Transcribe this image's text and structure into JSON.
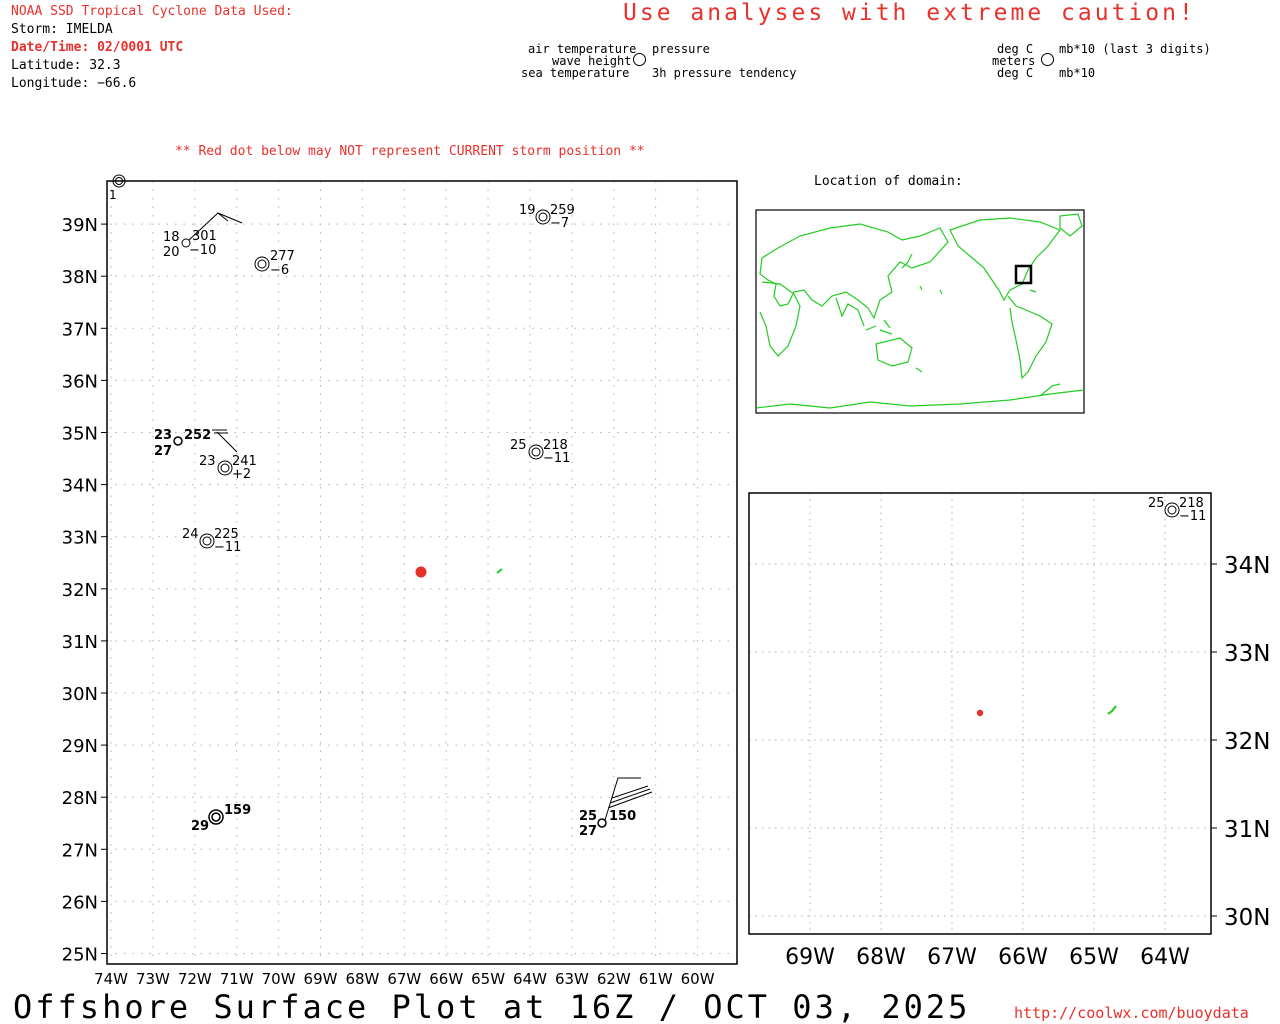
{
  "header": {
    "source": "NOAA SSD Tropical Cyclone Data Used:",
    "storm": "Storm: IMELDA",
    "datetime": "Date/Time: 02/0001 UTC",
    "latitude": "Latitude: 32.3",
    "longitude": "Longitude: −66.6",
    "caution": "Use analyses with extreme caution!"
  },
  "legend": {
    "air_temperature": "air temperature",
    "wave_height": "wave height",
    "sea_temperature": "sea temperature",
    "pressure": "pressure",
    "pressure_tendency": "3h pressure tendency",
    "deg_c_top": "deg C",
    "meters": "meters",
    "deg_c_bottom": "deg C",
    "mb_last3": "mb*10 (last 3 digits)",
    "mb": "mb*10"
  },
  "warning": "** Red dot below may NOT represent CURRENT storm position **",
  "location_title": "Location of domain:",
  "main_map": {
    "lat_labels": [
      "25N",
      "26N",
      "27N",
      "28N",
      "29N",
      "30N",
      "31N",
      "32N",
      "33N",
      "34N",
      "35N",
      "36N",
      "37N",
      "38N",
      "39N"
    ],
    "lon_labels": [
      "74W",
      "73W",
      "72W",
      "71W",
      "70W",
      "69W",
      "68W",
      "67W",
      "66W",
      "65W",
      "64W",
      "63W",
      "62W",
      "61W",
      "60W"
    ]
  },
  "stations": [
    {
      "id": "st-edge",
      "t1": "",
      "t2": "",
      "p": "",
      "tend": "",
      "extra": "1"
    },
    {
      "id": "st-a",
      "t1": "18",
      "t2": "20",
      "p": "301",
      "tend": "−10"
    },
    {
      "id": "st-b",
      "t1": "",
      "t2": "",
      "p": "277",
      "tend": "−6"
    },
    {
      "id": "st-c",
      "t1": "19",
      "t2": "",
      "p": "259",
      "tend": "−7"
    },
    {
      "id": "st-d",
      "t1": "23",
      "t2": "27",
      "p": "252",
      "tend": ""
    },
    {
      "id": "st-e",
      "t1": "23",
      "t2": "",
      "p": "241",
      "tend": "+2"
    },
    {
      "id": "st-f",
      "t1": "25",
      "t2": "",
      "p": "218",
      "tend": "−11"
    },
    {
      "id": "st-g",
      "t1": "24",
      "t2": "",
      "p": "225",
      "tend": "−11"
    },
    {
      "id": "st-h",
      "t1": "",
      "t2": "29",
      "p": "159",
      "tend": ""
    },
    {
      "id": "st-i",
      "t1": "25",
      "t2": "27",
      "p": "150",
      "tend": ""
    }
  ],
  "storm_position": {
    "lat": 32.3,
    "lon": -66.6,
    "color": "#e8302c"
  },
  "zoom_map": {
    "lat_labels": [
      "30N",
      "31N",
      "32N",
      "33N",
      "34N"
    ],
    "lon_labels": [
      "69W",
      "68W",
      "67W",
      "66W",
      "65W",
      "64W"
    ],
    "station": {
      "t1": "25",
      "p": "218",
      "tend": "−11"
    }
  },
  "colors": {
    "land": "#22cc22",
    "red": "#e8302c",
    "grid": "#b0b0b0"
  },
  "footer": {
    "title": "Offshore Surface Plot at 16Z / OCT 03, 2025",
    "url": "http://coolwx.com/buoydata"
  }
}
